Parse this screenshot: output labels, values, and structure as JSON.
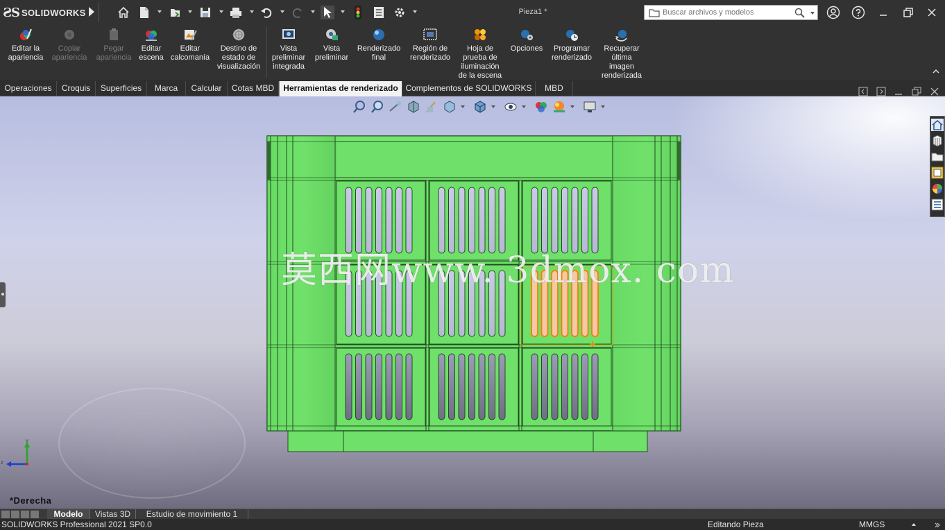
{
  "app": {
    "brand_ds": "ƧS",
    "brand_name": "SOLIDWORKS",
    "document_title": "Pieza1 *"
  },
  "search": {
    "placeholder": "Buscar archivos y modelos"
  },
  "quick_access": [
    "home-icon",
    "new-document-icon",
    "open-icon",
    "save-icon",
    "print-icon",
    "undo-icon",
    "redo-icon",
    "select-icon",
    "rebuild-icon",
    "file-properties-icon",
    "options-gear-icon"
  ],
  "ribbon": {
    "buttons": [
      {
        "label": "Editar la\napariencia",
        "icon": "edit-appearance-icon",
        "enabled": true
      },
      {
        "label": "Copiar\napariencia",
        "icon": "copy-appearance-icon",
        "enabled": false
      },
      {
        "label": "Pegar\napariencia",
        "icon": "paste-appearance-icon",
        "enabled": false
      },
      {
        "label": "Editar\nescena",
        "icon": "edit-scene-icon",
        "enabled": true
      },
      {
        "label": "Editar\ncalcomanía",
        "icon": "edit-decal-icon",
        "enabled": true
      },
      {
        "label": "Destino de\nestado de\nvisualización",
        "icon": "display-state-target-icon",
        "enabled": true
      },
      {
        "label": "Vista\npreliminar\nintegrada",
        "icon": "integrated-preview-icon",
        "enabled": true
      },
      {
        "label": "Vista\npreliminar",
        "icon": "preview-window-icon",
        "enabled": true
      },
      {
        "label": "Renderizado\nfinal",
        "icon": "final-render-icon",
        "enabled": true
      },
      {
        "label": "Región de\nrenderizado",
        "icon": "render-region-icon",
        "enabled": true
      },
      {
        "label": "Hoja de\nprueba de\niluminación\nde la escena",
        "icon": "scene-illumination-proof-icon",
        "enabled": true
      },
      {
        "label": "Opciones",
        "icon": "render-options-icon",
        "enabled": true
      },
      {
        "label": "Programar\nrenderizado",
        "icon": "schedule-render-icon",
        "enabled": true
      },
      {
        "label": "Recuperar\núltima\nimagen\nrenderizada",
        "icon": "recall-last-render-icon",
        "enabled": true
      }
    ]
  },
  "tabs": [
    {
      "label": "Operaciones",
      "active": false
    },
    {
      "label": "Croquis",
      "active": false
    },
    {
      "label": "Superficies",
      "active": false
    },
    {
      "label": "Marca",
      "active": false
    },
    {
      "label": "Calcular",
      "active": false
    },
    {
      "label": "Cotas MBD",
      "active": false
    },
    {
      "label": "Herramientas de renderizado",
      "active": true
    },
    {
      "label": "Complementos de SOLIDWORKS",
      "active": false
    },
    {
      "label": "MBD",
      "active": false
    }
  ],
  "heads_up_toolbar": [
    "zoom-to-fit-icon",
    "zoom-to-area-icon",
    "previous-view-icon",
    "section-view-icon",
    "dynamic-annotation-icon",
    "view-orientation-icon",
    "display-style-icon",
    "hide-show-items-icon",
    "edit-appearance-icon",
    "apply-scene-icon",
    "view-settings-icon"
  ],
  "task_pane": [
    "solidworks-resources-icon",
    "design-library-icon",
    "file-explorer-icon",
    "view-palette-icon",
    "appearances-scenes-icon",
    "custom-properties-icon"
  ],
  "viewport": {
    "view_name": "*Derecha",
    "watermark": "莫西网www. 3dmox. com",
    "model_color": "#6fe06a",
    "highlight_color": "#ff7a00",
    "triad_axes": [
      "y",
      "z"
    ]
  },
  "bottom_tabs": [
    {
      "label": "Modelo",
      "active": true
    },
    {
      "label": "Vistas 3D",
      "active": false
    },
    {
      "label": "Estudio de movimiento 1",
      "active": false
    }
  ],
  "status": {
    "product": "SOLIDWORKS Professional 2021 SP0.0",
    "mode": "Editando Pieza",
    "units": "MMGS"
  }
}
